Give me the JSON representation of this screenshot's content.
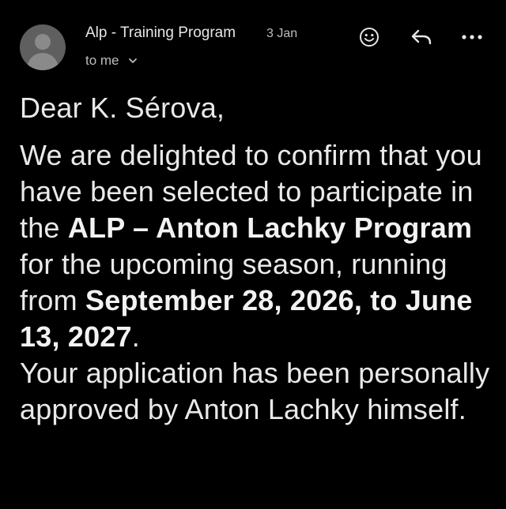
{
  "header": {
    "sender_name": "Alp - Training Program",
    "date": "3 Jan",
    "recipient_label": "to me",
    "icons": {
      "avatar": "default-avatar-icon",
      "emoji": "smiley-icon",
      "reply": "reply-arrow-icon",
      "more": "more-dots-icon",
      "details": "chevron-down-icon"
    }
  },
  "message": {
    "greeting": "Dear K. Sérova,",
    "p1_a": "We are delighted to confirm that you have been selected to participate in the ",
    "p1_program": "ALP – Anton Lachky Program",
    "p1_b": " for the upcoming season, running from ",
    "p1_dates": "September 28, 2026, to June 13, 2027",
    "p1_c": ".",
    "p2": "Your application has been personally approved by Anton Lachky himself."
  },
  "colors": {
    "background": "#000000",
    "text": "#e9e9e9",
    "muted_text": "#bdbdbd",
    "avatar_bg": "#5f5f5f"
  }
}
